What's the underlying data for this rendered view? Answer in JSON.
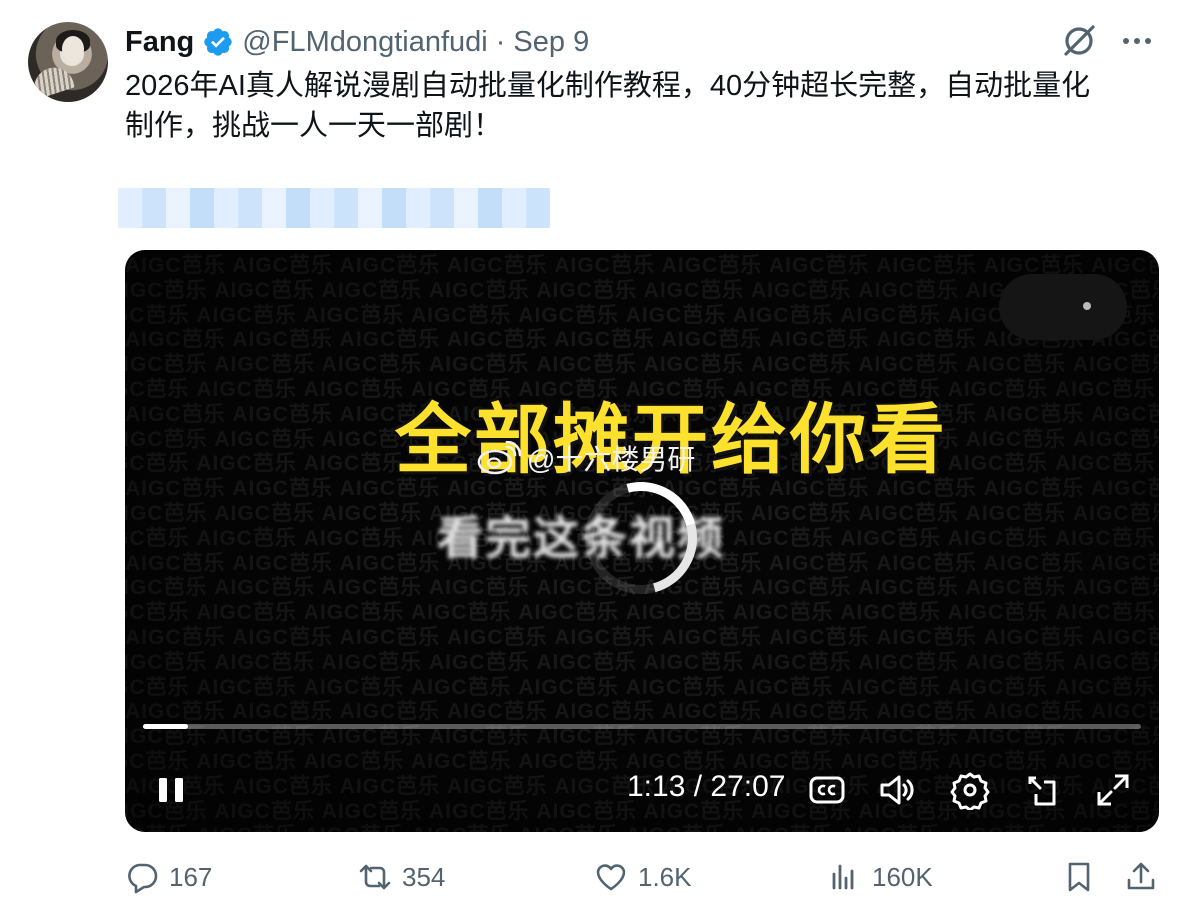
{
  "author": {
    "name": "Fang",
    "handle": "@FLMdongtianfudi",
    "separator": "·",
    "date": "Sep 9",
    "verified_color": "#1d9bf0"
  },
  "header_icons": [
    "grok-icon",
    "more-icon"
  ],
  "tweet": {
    "text": "2026年AI真人解说漫剧自动批量化制作教程，40分钟超长完整，自动批量化\n制作，挑战一人一天一部剧！"
  },
  "video": {
    "watermark_text": "AIGC芭乐",
    "headline": "全部摊开给你看",
    "weibo_handle": "@十六楼男研",
    "subline": "看完这条视频",
    "state": "playing",
    "loading": true,
    "progress_fraction": 0.045,
    "current_time": "1:13",
    "time_separator": "/",
    "duration": "27:07",
    "controls": [
      "pause-icon",
      "captions-icon",
      "volume-icon",
      "settings-icon",
      "pip-icon",
      "fullscreen-icon"
    ],
    "headline_color": "#fde12d"
  },
  "actions": {
    "replies": "167",
    "reposts": "354",
    "likes": "1.6K",
    "views": "160K",
    "icons": [
      "reply-icon",
      "repost-icon",
      "like-icon",
      "views-icon",
      "bookmark-icon",
      "share-icon"
    ]
  }
}
